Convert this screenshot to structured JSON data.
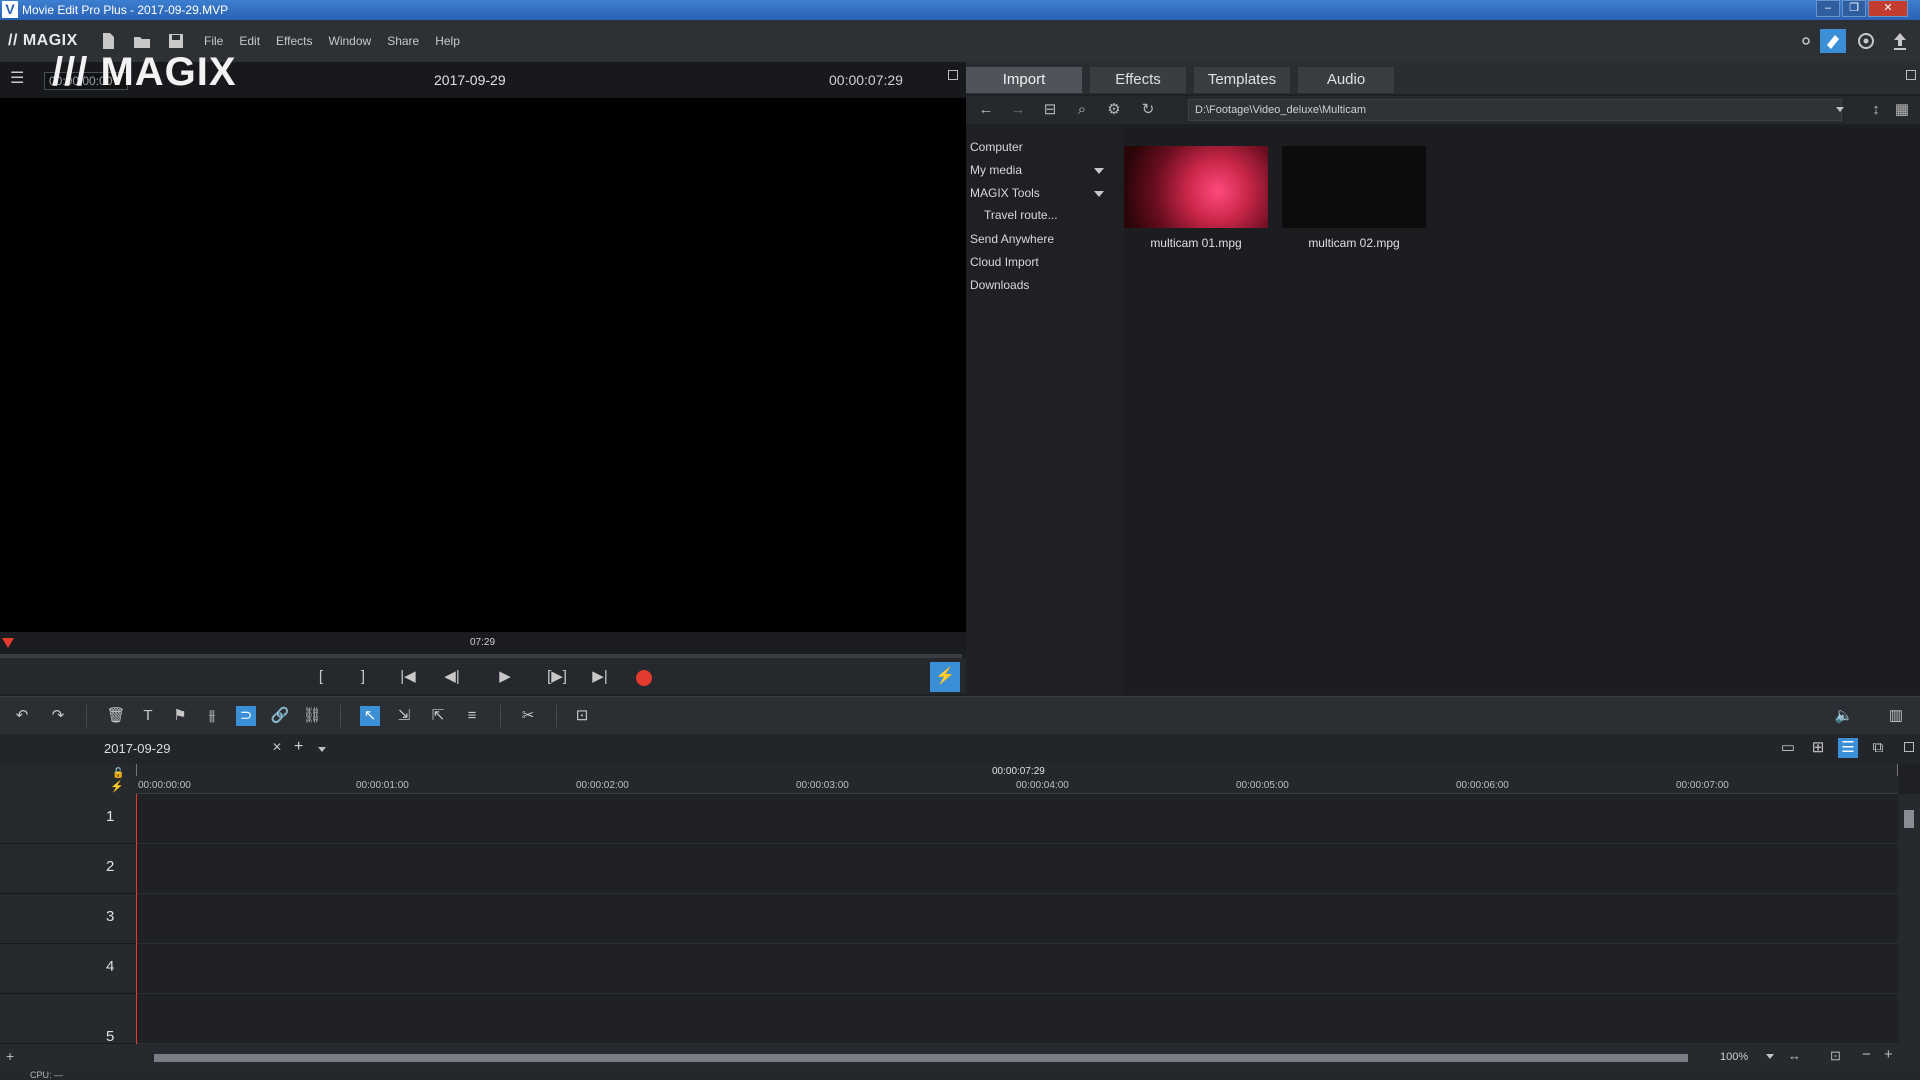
{
  "window": {
    "app_icon": "V",
    "title": "Movie Edit Pro Plus - 2017-09-29.MVP",
    "controls": [
      "‒",
      "❐",
      "✕"
    ]
  },
  "menubar": {
    "brand": "// MAGIX",
    "menus": [
      "File",
      "Edit",
      "Effects",
      "Window",
      "Share",
      "Help"
    ]
  },
  "preview": {
    "brand_overlay": "/// MAGIX",
    "timecode_field": "00:00:00:00",
    "project_date": "2017-09-29",
    "duration": "00:00:07:29",
    "scrub_marker": "07:29",
    "transport": {
      "mark_in": "[",
      "mark_out": "]",
      "go_start": "|◀",
      "prev_frame": "◀|",
      "play": "▶",
      "play_range": "[▶]",
      "go_end": "▶|"
    }
  },
  "media_pool": {
    "tabs": [
      "Import",
      "Effects",
      "Templates",
      "Audio"
    ],
    "active_tab": "Import",
    "path": "D:\\Footage\\Video_deluxe\\Multicam",
    "tree": [
      {
        "label": "Computer",
        "expandable": false
      },
      {
        "label": "My media",
        "expandable": true
      },
      {
        "label": "MAGIX Tools",
        "expandable": true
      },
      {
        "label": "Travel route...",
        "expandable": false,
        "indent": true
      },
      {
        "label": "Send Anywhere",
        "expandable": false
      },
      {
        "label": "Cloud Import",
        "expandable": false
      },
      {
        "label": "Downloads",
        "expandable": false
      }
    ],
    "files": [
      {
        "name": "multicam 01.mpg",
        "thumb": "guitar"
      },
      {
        "name": "multicam 02.mpg",
        "thumb": "dark"
      }
    ]
  },
  "timeline": {
    "project_tab": "2017-09-29",
    "close_label": "✕",
    "add_label": "+",
    "duration_marker": "00:00:07:29",
    "ruler_ticks": [
      "00:00:00:00",
      "00:00:01:00",
      "00:00:02:00",
      "00:00:03:00",
      "00:00:04:00",
      "00:00:05:00",
      "00:00:06:00",
      "00:00:07:00"
    ],
    "tracks": [
      "1",
      "2",
      "3",
      "4",
      "5"
    ],
    "zoom": "100%"
  },
  "status": {
    "cpu": "CPU: —"
  },
  "colors": {
    "accent": "#3a8fd6",
    "record": "#e53b2f",
    "titlebar": "#2a62b4"
  }
}
